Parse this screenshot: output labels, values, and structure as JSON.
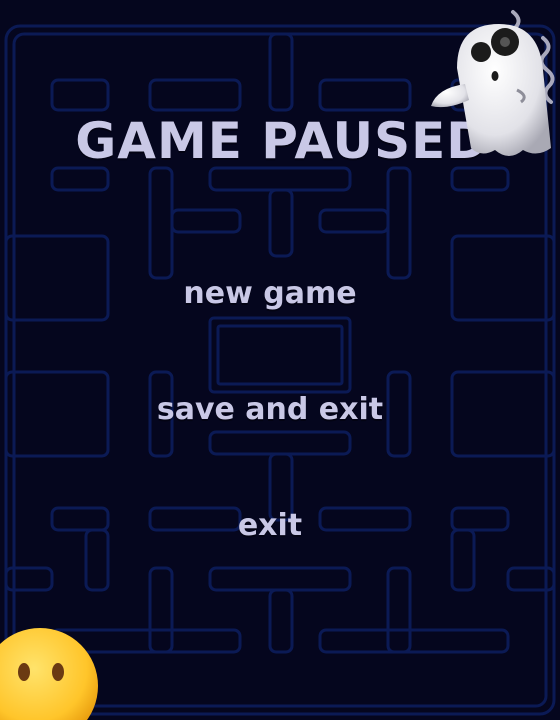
{
  "title": "GAME PAUSED",
  "menu": {
    "new_game": "new game",
    "save_and_exit": "save and exit",
    "exit": "exit"
  },
  "decorations": {
    "top_right": "ghost-emoji",
    "bottom_left": "hushed-face-emoji"
  },
  "colors": {
    "background": "#05061e",
    "maze_wall": "#0b1a55",
    "text": "#c9c8e6"
  }
}
